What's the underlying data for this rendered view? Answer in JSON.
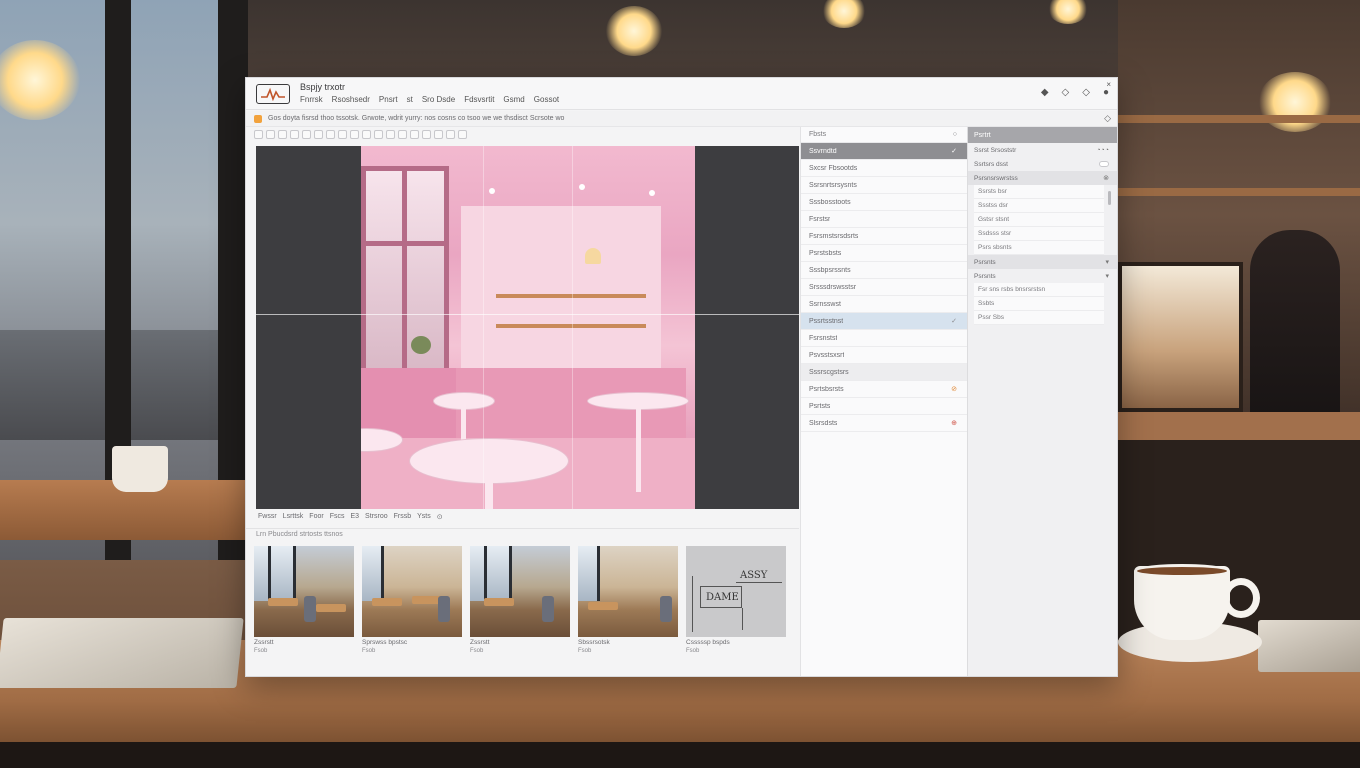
{
  "window": {
    "title": "Bspjy trxotr",
    "menu": [
      "Fnrrsk",
      "Rsoshsedr",
      "Pnsrt",
      "st",
      "Sro Dsde",
      "Fdsvsrtit",
      "Gsmd",
      "Gossot"
    ],
    "controls": [
      "◆",
      "◇",
      "◇",
      "●"
    ],
    "close": "×"
  },
  "notice": {
    "text": "Gos doyta fisrsd thoo tssotsk. Grwote, wdrit yurry: nos cosns co tsoo we we thsdisct Scrsote wo",
    "icon": "◇"
  },
  "canvas": {
    "status": [
      "Fwssr",
      "Lsrttsk",
      "Foor",
      "Fscs",
      "E3",
      "Strsroo",
      "Frssb",
      "Ysts",
      "⊙"
    ]
  },
  "filmstrip": {
    "title": "Lrn Pbucdsrd strtosts ttsnos",
    "items": [
      {
        "label": "Zssrstt",
        "sub": "Fsob"
      },
      {
        "label": "Sprswss bpstsc",
        "sub": "Fsob"
      },
      {
        "label": "Zssrstt",
        "sub": "Fsob"
      },
      {
        "label": "Sbssrsotsk",
        "sub": "Fsob"
      },
      {
        "label": "Csssssp bspds",
        "sub": "Fsob",
        "diagram_left": "DAME",
        "diagram_right": "ASSY"
      }
    ]
  },
  "list_panel": {
    "header": "Fbsts",
    "items": [
      {
        "label": "Ssvrndtd",
        "icon": "✓",
        "style": "dark"
      },
      {
        "label": "Sxcsr Fbsootds",
        "icon": "",
        "style": "normal"
      },
      {
        "label": "Ssrsnrtsrsysnts",
        "icon": "",
        "style": "normal"
      },
      {
        "label": "Sssbosstoots",
        "icon": "",
        "style": "normal"
      },
      {
        "label": "Fsrstsr",
        "icon": "",
        "style": "normal"
      },
      {
        "label": "Fsrsmstsrsdsrts",
        "icon": "",
        "style": "normal"
      },
      {
        "label": "Psrstsbsts",
        "icon": "",
        "style": "normal"
      },
      {
        "label": "Sssbpsrssnts",
        "icon": "",
        "style": "normal"
      },
      {
        "label": "Srsssdrswsstsr",
        "icon": "",
        "style": "normal"
      },
      {
        "label": "Ssrnsswst",
        "icon": "",
        "style": "normal"
      },
      {
        "label": "Pssrtsstnst",
        "icon": "✓",
        "style": "sel"
      },
      {
        "label": "Fsrsnstst",
        "icon": "",
        "style": "normal"
      },
      {
        "label": "Psvsstsxsrt",
        "icon": "",
        "style": "normal"
      },
      {
        "label": "Sssrscgstsrs",
        "icon": "",
        "style": "grey"
      },
      {
        "label": "Psrtsbsrsts",
        "icon": "⊘",
        "style": "normal"
      },
      {
        "label": "Psrtsts",
        "icon": "",
        "style": "normal"
      },
      {
        "label": "Slsrsdsts",
        "icon": "⊕",
        "style": "normal"
      }
    ]
  },
  "props_panel": {
    "header": "Psrtrt",
    "rows": [
      {
        "label": "Ssrst Srsoststr",
        "ctrl": "◔◔◔",
        "shade": false
      },
      {
        "label": "Ssrtsrs dsst",
        "ctrl": "toggle",
        "shade": false
      },
      {
        "label": "Psrsnsrswrstss",
        "ctrl": "⊗",
        "shade": true
      }
    ],
    "subs": [
      "Ssrsts bsr",
      "Ssstss dsr",
      "Gstsr stsnt",
      "Ssdsss stsr",
      "Psrs sbsnts"
    ],
    "rows2": [
      {
        "label": "Psrsnts",
        "ctrl": "▾",
        "shade": true
      },
      {
        "label": "Psrsnts",
        "ctrl": "▾",
        "shade": false
      }
    ],
    "subs2": [
      "Fsr sns rsbs bnsrsrstsn",
      "Ssbts",
      "Pssr Sbs"
    ]
  }
}
